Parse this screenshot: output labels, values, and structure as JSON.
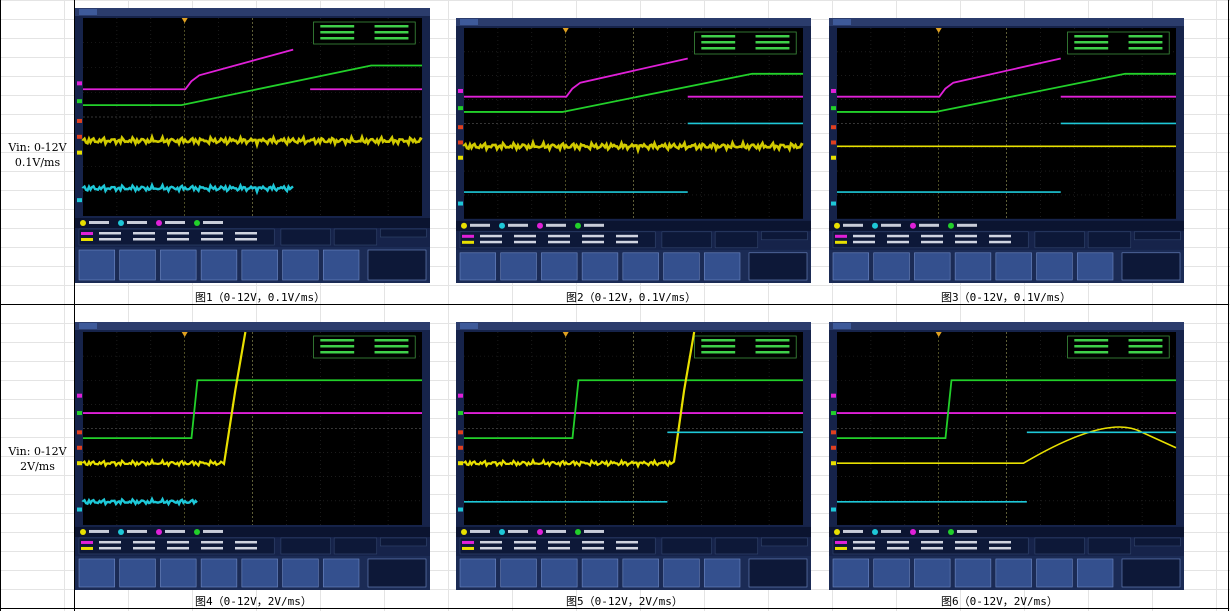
{
  "rows": [
    {
      "label_line1": "Vin: 0-12V",
      "label_line2": "0.1V/ms",
      "figures": [
        {
          "caption": "图1（0-12V，0.1V/ms）"
        },
        {
          "caption": "图2（0-12V，0.1V/ms）"
        },
        {
          "caption": "图3（0-12V，0.1V/ms）"
        }
      ]
    },
    {
      "label_line1": "Vin: 0-12V",
      "label_line2": "2V/ms",
      "figures": [
        {
          "caption": "图4（0-12V，2V/ms）"
        },
        {
          "caption": "图5（0-12V，2V/ms）"
        },
        {
          "caption": "图6（0-12V，2V/ms）"
        }
      ]
    }
  ],
  "colors": {
    "ch1_yellow": "#e8e000",
    "ch2_cyan": "#1ec8d8",
    "ch3_magenta": "#e020d8",
    "ch4_green": "#22d02a"
  }
}
